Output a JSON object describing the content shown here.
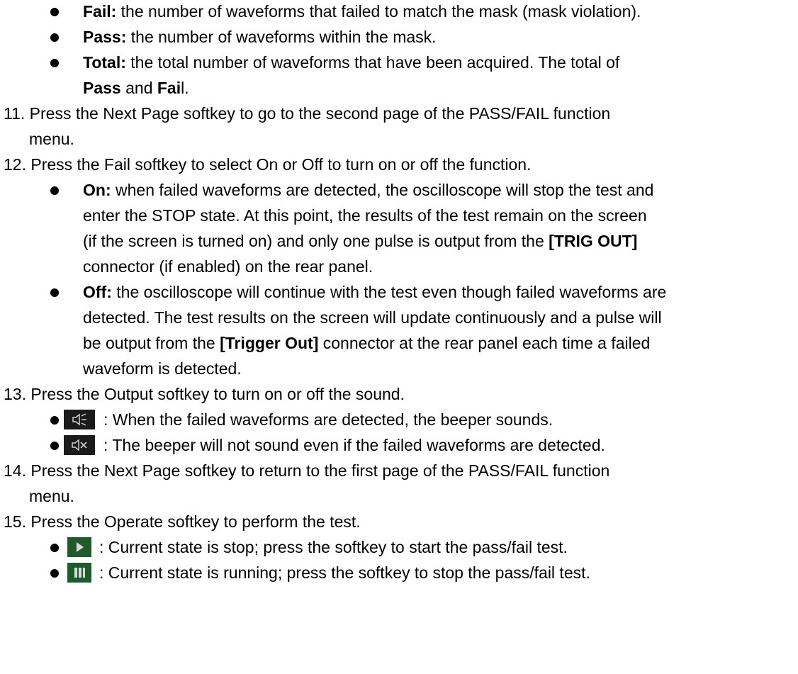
{
  "items": {
    "fail_label": "Fail:",
    "fail_text": " the number of waveforms that failed to match the mask (mask violation).",
    "pass_label": "Pass:",
    "pass_text": " the number of waveforms within the mask.",
    "total_label": "Total:",
    "total_text_1": " the total number of waveforms that have been acquired. The total of",
    "total_text_2_a": "Pass",
    "total_text_2_b": " and ",
    "total_text_2_c": "Fai",
    "total_text_2_d": "l."
  },
  "step11": {
    "line1": "11. Press the Next Page softkey to go to the second page of the PASS/FAIL function",
    "line2": "menu."
  },
  "step12": {
    "line1": "12. Press the Fail softkey to select On or Off to turn on or off the function.",
    "on_label": "On:",
    "on_text_1": " when failed waveforms are detected, the oscilloscope will stop the test and",
    "on_text_2": "enter the STOP state. At this point, the results of the test remain on the screen",
    "on_text_3_a": "(if the screen is turned on) and only one pulse is output from the ",
    "on_text_3_b": "[TRIG OUT]",
    "on_text_4": "connector (if enabled) on the rear panel.",
    "off_label": "Off:",
    "off_text_1": " the oscilloscope will continue with the test even though failed waveforms are",
    "off_text_2": "detected. The test results on the screen will update continuously and a pulse will",
    "off_text_3_a": "be output from the ",
    "off_text_3_b": "[Trigger Out]",
    "off_text_3_c": " connector at the rear panel each time a failed",
    "off_text_4": "waveform is detected."
  },
  "step13": {
    "line1": "13. Press the Output softkey to turn on or off the sound.",
    "sound_on_text": ": When the failed waveforms are detected, the beeper sounds.",
    "sound_off_text": ": The beeper will not sound even if the failed waveforms are detected."
  },
  "step14": {
    "line1": "14. Press the Next Page softkey to return to the first page of the PASS/FAIL function",
    "line2": "menu."
  },
  "step15": {
    "line1": "15. Press the Operate softkey to perform the test.",
    "stop_text": ": Current state is stop; press the softkey to start the pass/fail test.",
    "run_text": ": Current state is running; press the softkey to stop the pass/fail test."
  },
  "icons": {
    "sound_on": "speaker-on-icon",
    "sound_off": "speaker-mute-icon",
    "play": "play-icon",
    "pause": "pause-icon"
  },
  "colors": {
    "icon_dark_bg": "#1a1a1a",
    "icon_green_bg": "#1f5a2c",
    "icon_fg": "#cfcfcf"
  }
}
